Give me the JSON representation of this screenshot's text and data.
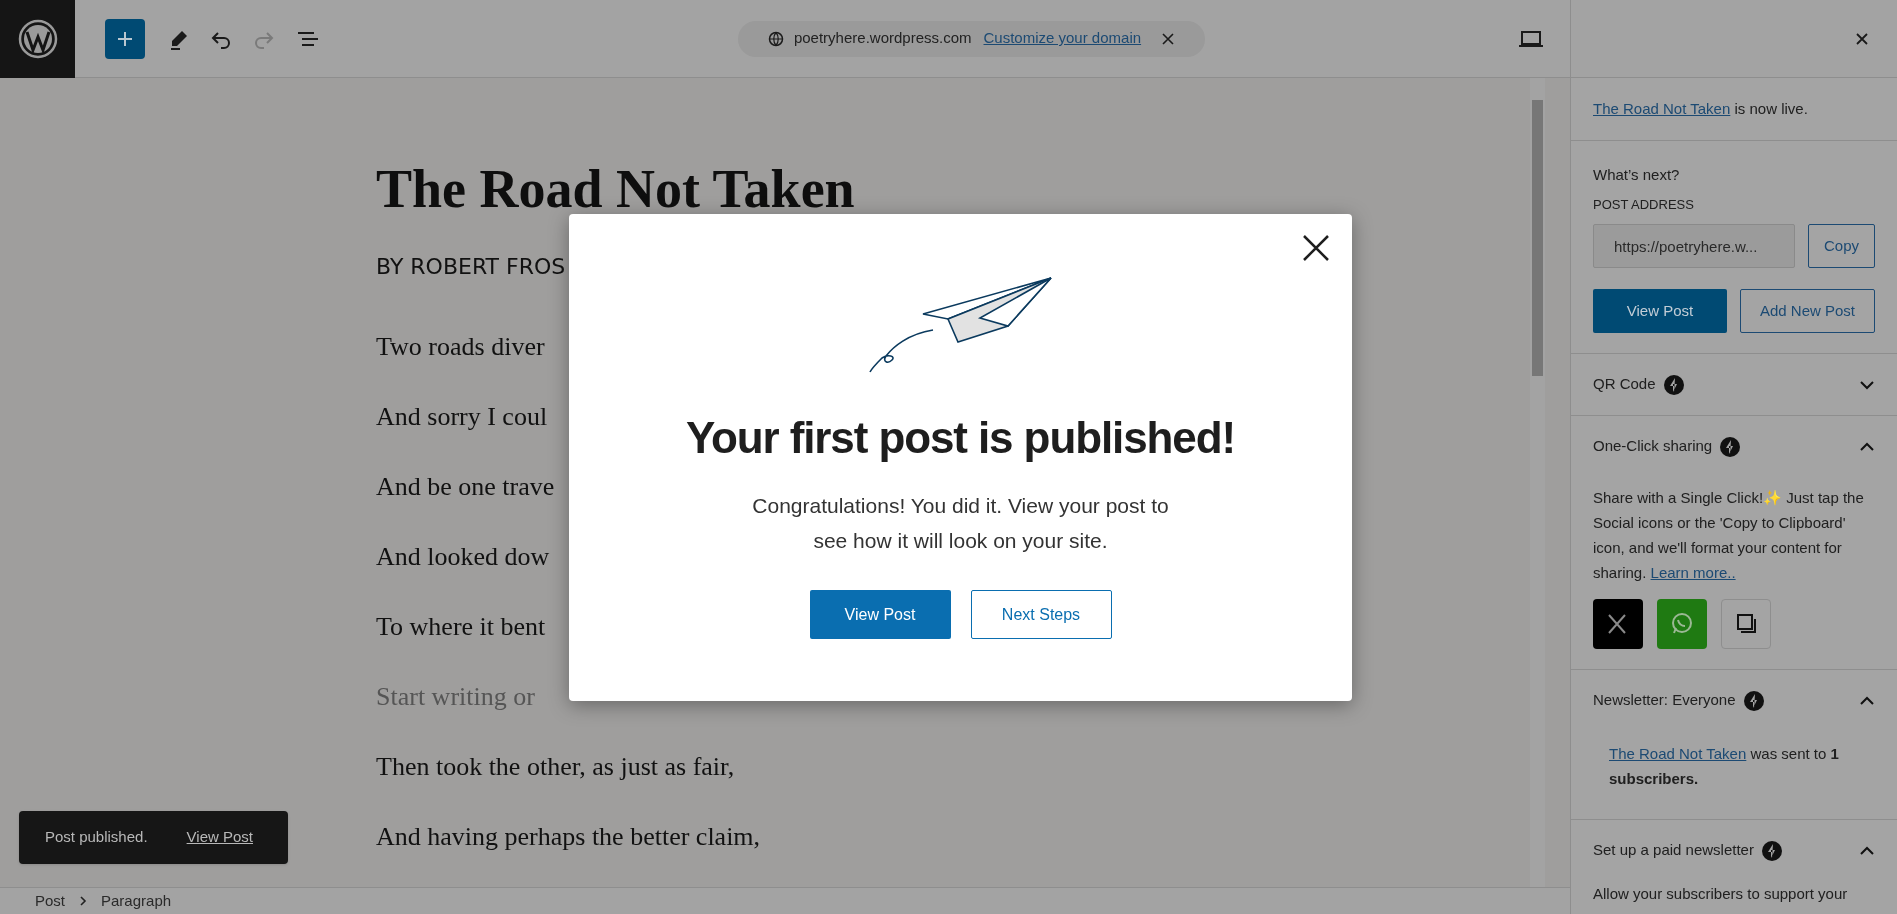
{
  "toolbar": {
    "site_address": "poetryhere.wordpress.com",
    "domain_link": "Customize your domain"
  },
  "editor": {
    "title": "The Road Not Taken",
    "byline": "BY ROBERT FROS",
    "lines": [
      {
        "kind": "verse",
        "text": "Two roads diver"
      },
      {
        "kind": "verse",
        "text": "And sorry I coul"
      },
      {
        "kind": "verse",
        "text": "And be one trave"
      },
      {
        "kind": "verse",
        "text": "And looked dow"
      },
      {
        "kind": "verse",
        "text": "To where it bent"
      },
      {
        "kind": "placeholder",
        "text": "Start writing or"
      },
      {
        "kind": "verse",
        "text": "Then took the other, as just as fair,"
      },
      {
        "kind": "verse",
        "text": "And having perhaps the better claim,"
      }
    ]
  },
  "modal": {
    "heading": "Your first post is published!",
    "message": "Congratulations! You did it. View your post to see how it will look on your site.",
    "buttons": [
      {
        "label": "View Post",
        "kind": "primary"
      },
      {
        "label": "Next Steps",
        "kind": "secondary"
      }
    ]
  },
  "snackbar": {
    "message": "Post published.",
    "action": "View Post"
  },
  "breadcrumb": [
    "Post",
    "Paragraph"
  ],
  "sidebar": {
    "live_notice": {
      "link": "The Road Not Taken",
      "text": "is now live."
    },
    "whats_next": "What’s next?",
    "address_label": "POST ADDRESS",
    "address_value": "https://poetryhere.w...",
    "copy": "Copy",
    "buttons": [
      {
        "label": "View Post",
        "kind": "primary"
      },
      {
        "label": "Add New Post",
        "kind": "secondary"
      }
    ],
    "panels": [
      {
        "title": "QR Code",
        "expanded": false
      },
      {
        "title": "One-Click sharing",
        "expanded": true,
        "text": "Share with a Single Click!✨ Just tap the Social icons or the 'Copy to Clipboard' icon, and we'll format your content for sharing.",
        "link": "Learn more..",
        "share": [
          {
            "kind": "x"
          },
          {
            "kind": "whatsapp"
          },
          {
            "kind": "copy"
          }
        ]
      },
      {
        "title": "Newsletter: Everyone",
        "expanded": true,
        "link": "The Road Not Taken",
        "text": "was sent to **1 subscribers.**"
      },
      {
        "title": "Set up a paid newsletter",
        "expanded": true,
        "text": "Allow your subscribers to support your"
      }
    ]
  }
}
